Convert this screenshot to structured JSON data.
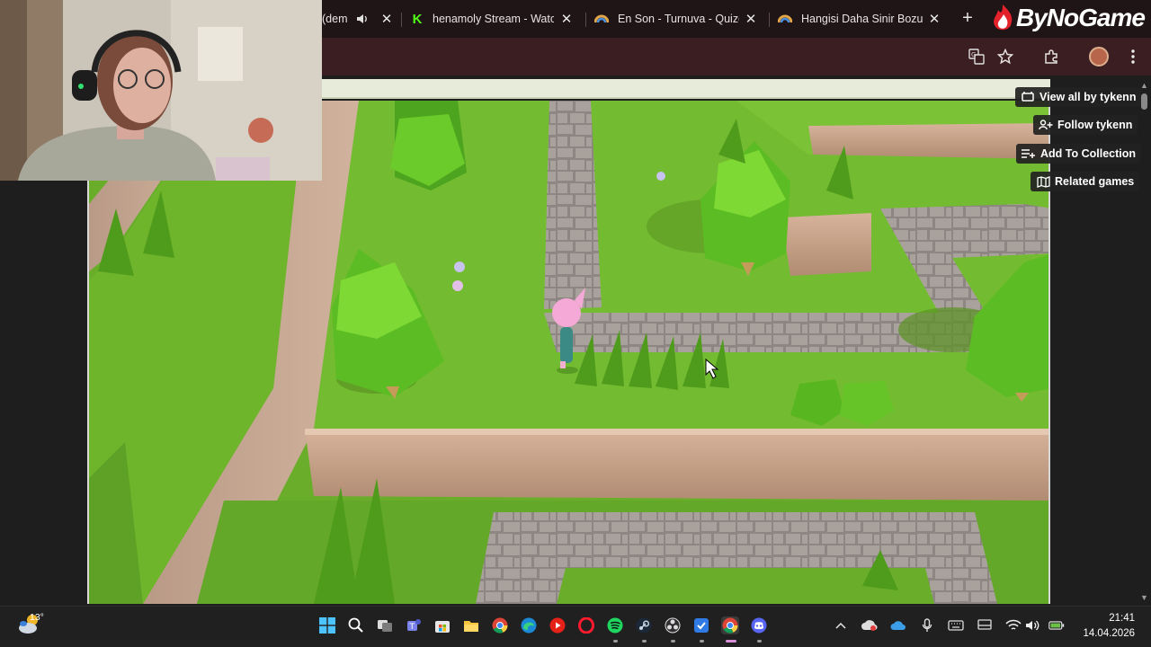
{
  "browser": {
    "tabs": [
      {
        "title": "(dem",
        "icon": "speaker-icon",
        "close": "✕",
        "favicon_color": "#cc3333"
      },
      {
        "title": "henamoly Stream - Watc",
        "favicon": "K",
        "favicon_color": "#53fc18",
        "close": "✕"
      },
      {
        "title": "En Son - Turnuva - Quize",
        "favicon_color": "#e0a64a",
        "close": "✕"
      },
      {
        "title": "Hangisi Daha Sinir Bozuc",
        "favicon_color": "#e0a64a",
        "close": "✕"
      }
    ],
    "new_tab": "+",
    "brand_logo": "ByNoGame",
    "toolbar_icons": [
      "translate-icon",
      "star-icon",
      "extensions-icon",
      "profile-avatar",
      "menu-icon"
    ]
  },
  "itch_overlay": {
    "view_all": "View all by tykenn",
    "follow": "Follow tykenn",
    "add_collection": "Add To Collection",
    "related": "Related games"
  },
  "taskbar": {
    "weather_temp": "13°",
    "apps": [
      "start",
      "search",
      "task-view",
      "teams",
      "store",
      "file-explorer",
      "chrome",
      "edge",
      "youtube",
      "opera",
      "spotify",
      "steam",
      "obs",
      "vpn",
      "chrome-active",
      "discord"
    ],
    "tray": [
      "overflow-chevron",
      "vpn-tray",
      "onedrive",
      "microphone",
      "keyboard",
      "display",
      "wifi",
      "volume",
      "battery"
    ],
    "time": "21:41",
    "date": "14.04.2026"
  },
  "colors": {
    "tab_strip": "#1f1416",
    "toolbar": "#3a1e22",
    "grass": "#6fb62d",
    "stone": "#9e9691",
    "taskbar": "#202020"
  }
}
